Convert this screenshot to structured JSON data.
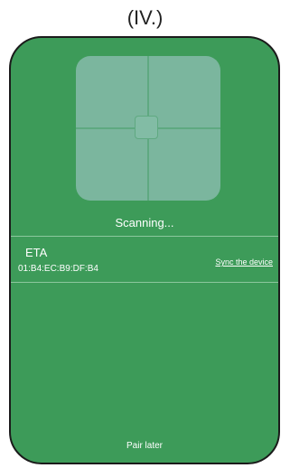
{
  "caption": "(IV.)",
  "scanner": {
    "status": "Scanning..."
  },
  "devices": [
    {
      "name": "ETA",
      "mac": "01:B4:EC:B9:DF:B4",
      "action_label": "Sync the device"
    }
  ],
  "footer": {
    "pair_later_label": "Pair later"
  },
  "colors": {
    "background": "#3d9b59",
    "scan_frame": "#7bb69e",
    "text": "#ffffff",
    "border": "#1b1b1b"
  }
}
